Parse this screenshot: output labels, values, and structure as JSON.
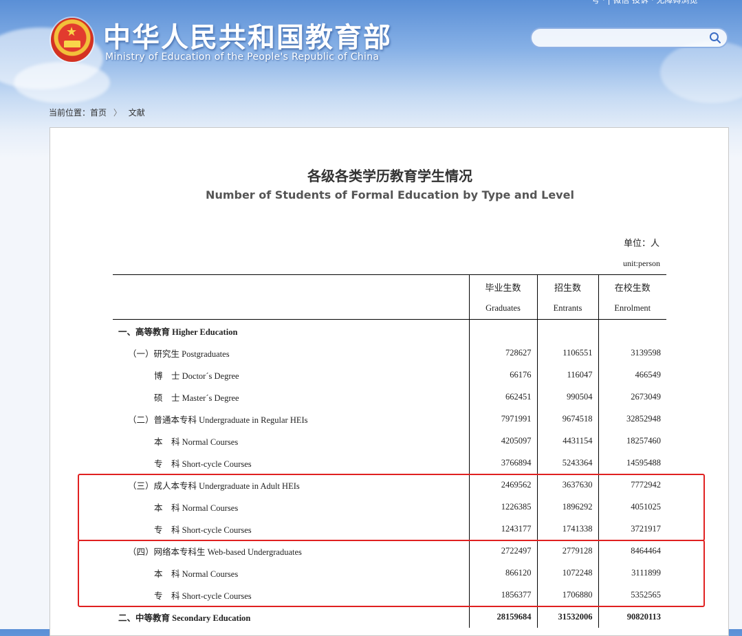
{
  "site": {
    "title_cn": "中华人民共和国教育部",
    "title_en": "Ministry of Education of the People's Republic of China",
    "top_links": "号   ·   | 微信 投诉 · 无障碍浏览"
  },
  "search": {
    "placeholder": ""
  },
  "breadcrumb": {
    "label": "当前位置：",
    "home": "首页",
    "separator": "〉",
    "current": "文献"
  },
  "doc": {
    "title_cn": "各级各类学历教育学生情况",
    "title_en": "Number of Students of Formal Education by Type and Level",
    "unit_cn": "单位：人",
    "unit_en": "unit:person"
  },
  "table": {
    "headers": [
      {
        "cn": "毕业生数",
        "en": "Graduates"
      },
      {
        "cn": "招生数",
        "en": "Entrants"
      },
      {
        "cn": "在校生数",
        "en": "Enrolment"
      }
    ],
    "rows": [
      {
        "label": "一、高等教育 Higher Education",
        "level": 0,
        "values": [
          "",
          "",
          ""
        ]
      },
      {
        "label": "（一）研究生 Postgraduates",
        "level": 1,
        "values": [
          "728627",
          "1106551",
          "3139598"
        ]
      },
      {
        "label": "博　士 Doctor´s Degree",
        "level": 2,
        "values": [
          "66176",
          "116047",
          "466549"
        ]
      },
      {
        "label": "硕　士 Master´s Degree",
        "level": 2,
        "values": [
          "662451",
          "990504",
          "2673049"
        ]
      },
      {
        "label": "（二）普通本专科 Undergraduate in Regular HEIs",
        "level": 1,
        "values": [
          "7971991",
          "9674518",
          "32852948"
        ]
      },
      {
        "label": "本　科 Normal Courses",
        "level": 2,
        "values": [
          "4205097",
          "4431154",
          "18257460"
        ]
      },
      {
        "label": "专　科 Short-cycle Courses",
        "level": 2,
        "values": [
          "3766894",
          "5243364",
          "14595488"
        ]
      },
      {
        "label": "（三）成人本专科 Undergraduate in Adult HEIs",
        "level": 1,
        "values": [
          "2469562",
          "3637630",
          "7772942"
        ]
      },
      {
        "label": "本　科 Normal Courses",
        "level": 2,
        "values": [
          "1226385",
          "1896292",
          "4051025"
        ]
      },
      {
        "label": "专　科 Short-cycle Courses",
        "level": 2,
        "values": [
          "1243177",
          "1741338",
          "3721917"
        ]
      },
      {
        "label": "（四）网络本专科生 Web-based Undergraduates",
        "level": 1,
        "values": [
          "2722497",
          "2779128",
          "8464464"
        ]
      },
      {
        "label": "本　科 Normal Courses",
        "level": 2,
        "values": [
          "866120",
          "1072248",
          "3111899"
        ]
      },
      {
        "label": "专　科 Short-cycle Courses",
        "level": 2,
        "values": [
          "1856377",
          "1706880",
          "5352565"
        ]
      },
      {
        "label": "二、中等教育 Secondary Education",
        "level": 0,
        "values": [
          "28159684",
          "31532006",
          "90820113"
        ]
      }
    ]
  },
  "highlight_color": "#e02020"
}
